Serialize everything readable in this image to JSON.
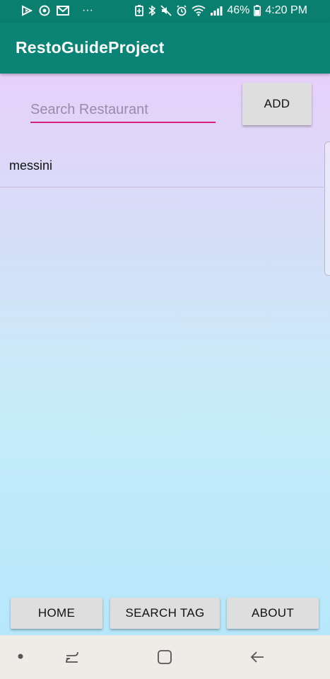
{
  "status_bar": {
    "battery_percent": "46%",
    "time": "4:20 PM",
    "more_indicator": "···"
  },
  "app_bar": {
    "title": "RestoGuideProject"
  },
  "search": {
    "placeholder": "Search Restaurant",
    "value": ""
  },
  "add_button": {
    "label": "ADD"
  },
  "restaurants": [
    {
      "name": "messini"
    }
  ],
  "bottom_buttons": {
    "home": "HOME",
    "search_tag": "SEARCH TAG",
    "about": "ABOUT"
  },
  "colors": {
    "primary": "#0b8475",
    "status_bar": "#0a7f6f",
    "accent": "#d8207a",
    "button_bg": "#dedede",
    "nav_bar": "#efebe7"
  },
  "icons": {
    "status_left": [
      "play-store-icon",
      "sync-icon",
      "gmail-icon"
    ],
    "status_right": [
      "battery-saver-icon",
      "bluetooth-icon",
      "mute-icon",
      "alarm-icon",
      "wifi-icon",
      "signal-icon",
      "battery-icon"
    ],
    "nav": [
      "dot-icon",
      "recent-apps-icon",
      "home-square-icon",
      "back-arrow-icon"
    ]
  }
}
